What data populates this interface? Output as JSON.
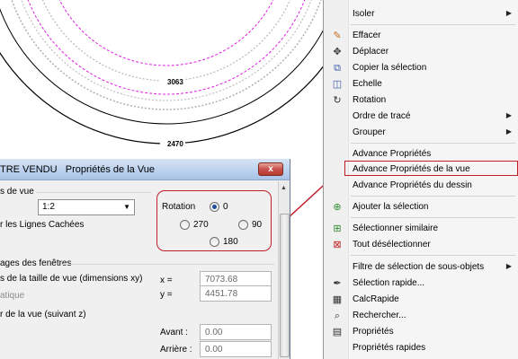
{
  "drawing": {
    "dim_outer": "3063",
    "dim_inner": "2470"
  },
  "dialog": {
    "title": "TRE VENDU   Propriétés de la Vue",
    "close_label": "x",
    "view_section": "s de vue",
    "scale_value": "1:2",
    "hidden_lines": "r les Lignes Cachées",
    "rotation": {
      "label": "Rotation",
      "options": [
        "0",
        "270",
        "90",
        "180"
      ],
      "selected": "0"
    },
    "windows_section": "ages des fenêtres",
    "view_size": "s de la taille de vue (dimensions xy)",
    "x_label": "x =",
    "x_value": "7073.68",
    "static_label": "atique",
    "y_label": "y =",
    "y_value": "4451.78",
    "view_depth": "r de la vue (suivant z)",
    "front_label": "Avant :",
    "front_value": "0.00",
    "back_label": "Arrière :",
    "back_value": "0.00"
  },
  "menu": {
    "items": [
      {
        "label": "Isoler",
        "icon": "none",
        "submenu": true
      },
      {
        "label": "Effacer",
        "icon": "eraser-icon",
        "submenu": false
      },
      {
        "label": "Déplacer",
        "icon": "move-icon",
        "submenu": false
      },
      {
        "label": "Copier la sélection",
        "icon": "copy-icon",
        "submenu": false
      },
      {
        "label": "Echelle",
        "icon": "scale-icon",
        "submenu": false
      },
      {
        "label": "Rotation",
        "icon": "rotate-icon",
        "submenu": false
      },
      {
        "label": "Ordre de tracé",
        "icon": "none",
        "submenu": true
      },
      {
        "label": "Grouper",
        "icon": "none",
        "submenu": true
      },
      {
        "label": "Advance Propriétés",
        "icon": "none",
        "submenu": false
      },
      {
        "label": "Advance Propriétés de la vue",
        "icon": "none",
        "submenu": false
      },
      {
        "label": "Advance Propriétés du dessin",
        "icon": "none",
        "submenu": false
      },
      {
        "label": "Ajouter la sélection",
        "icon": "add-selection-icon",
        "submenu": false
      },
      {
        "label": "Sélectionner similaire",
        "icon": "select-similar-icon",
        "submenu": false
      },
      {
        "label": "Tout désélectionner",
        "icon": "deselect-icon",
        "submenu": false
      },
      {
        "label": "Filtre de sélection de sous-objets",
        "icon": "none",
        "submenu": true
      },
      {
        "label": "Sélection rapide...",
        "icon": "quick-select-icon",
        "submenu": false
      },
      {
        "label": "CalcRapide",
        "icon": "calculator-icon",
        "submenu": false
      },
      {
        "label": "Rechercher...",
        "icon": "find-icon",
        "submenu": false
      },
      {
        "label": "Propriétés",
        "icon": "properties-icon",
        "submenu": false
      },
      {
        "label": "Propriétés rapides",
        "icon": "none",
        "submenu": false
      }
    ],
    "highlighted": "Advance Propriétés de la vue"
  },
  "colors": {
    "annotation_red": "#c0202a",
    "circle_magenta": "#e020e0",
    "menu_background": "#f5f5f5"
  }
}
